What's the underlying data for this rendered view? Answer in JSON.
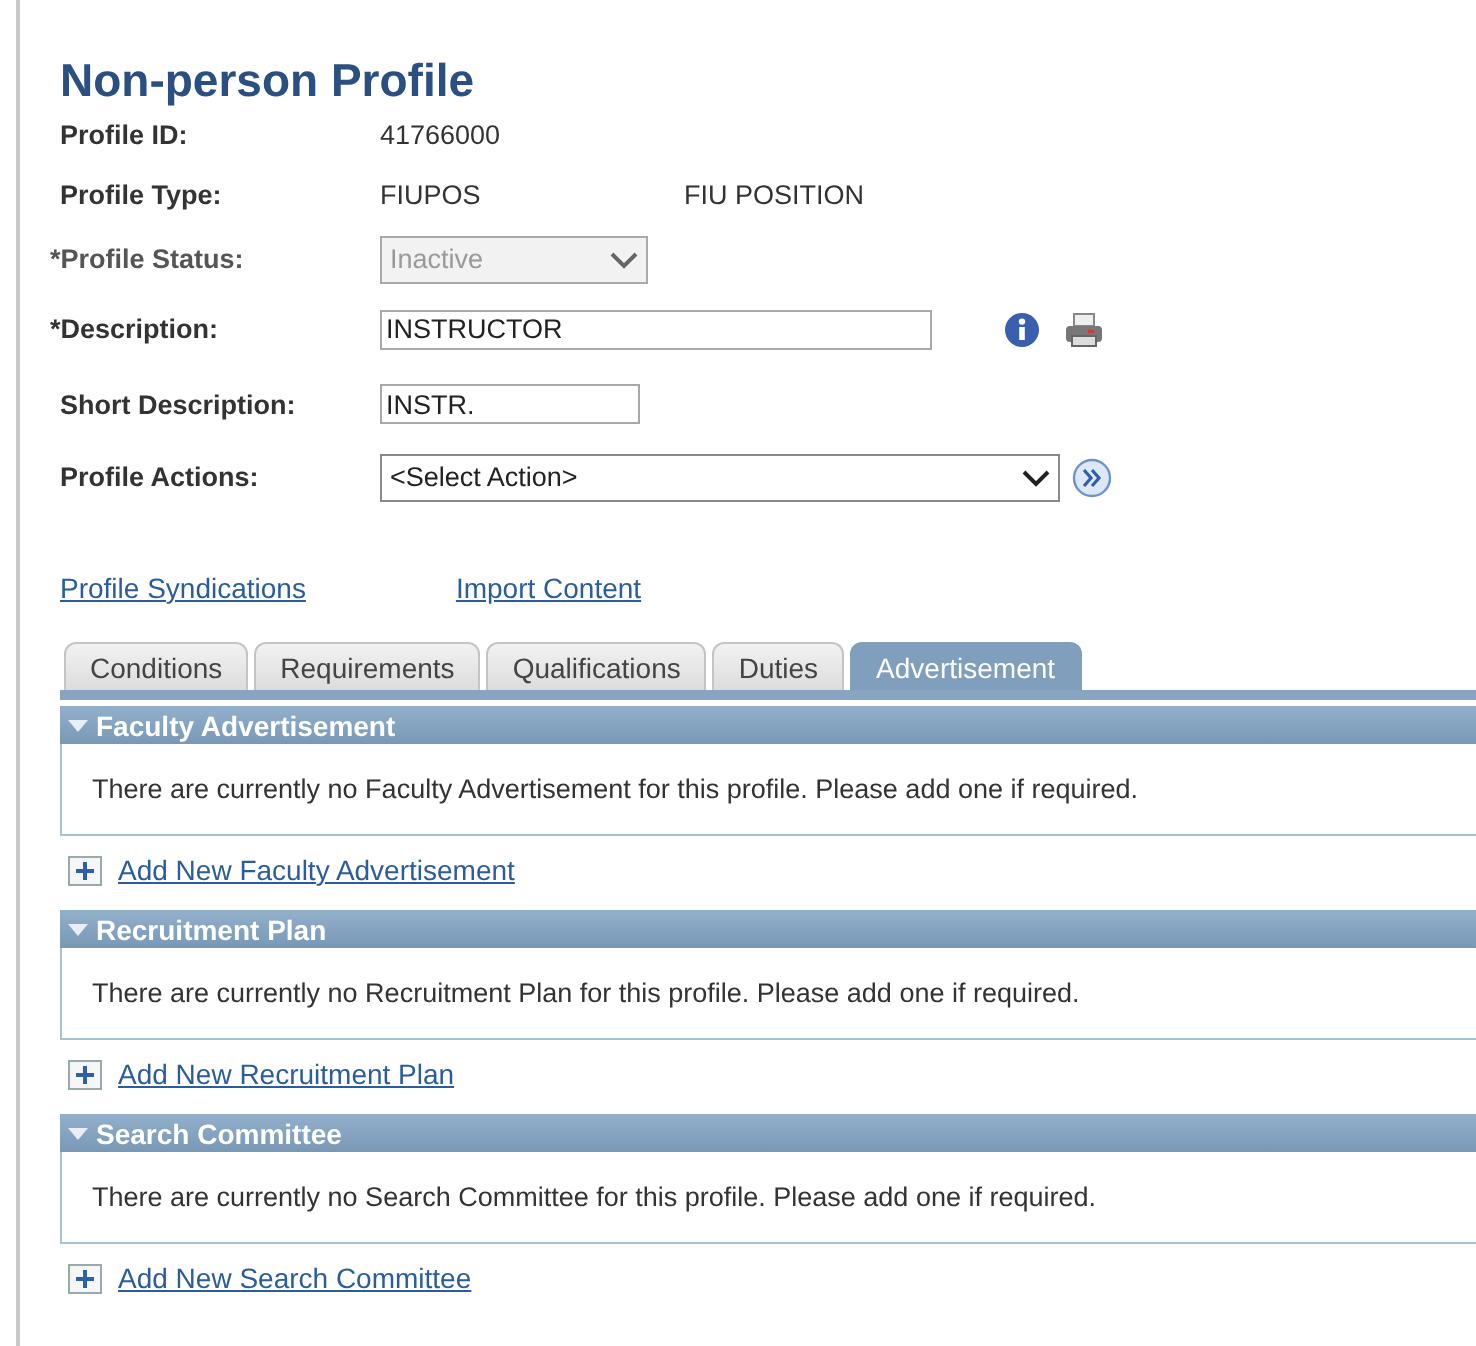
{
  "page_title": "Non-person Profile",
  "fields": [
    {
      "label": "Profile ID:",
      "kind": "text",
      "value": "41766000",
      "disabled": false
    },
    {
      "label": "Profile Type:",
      "kind": "text",
      "value": "FIUPOS",
      "value_2": "FIU POSITION",
      "disabled": false
    },
    {
      "label": "*Profile Status:",
      "kind": "select",
      "value": "Inactive",
      "disabled": true
    },
    {
      "label": "*Description:",
      "kind": "input_long",
      "value": "INSTRUCTOR",
      "disabled": false
    },
    {
      "label": "Short Description:",
      "kind": "input_short",
      "value": "INSTR.",
      "disabled": false
    },
    {
      "label": "Profile Actions:",
      "kind": "action_select",
      "value": "<Select Action>",
      "disabled": false
    }
  ],
  "links": [
    "Profile Syndications",
    "Import Content"
  ],
  "tabs": [
    {
      "label": "Conditions",
      "selected": false
    },
    {
      "label": "Requirements",
      "selected": false
    },
    {
      "label": "Qualifications",
      "selected": false
    },
    {
      "label": "Duties",
      "selected": false
    },
    {
      "label": "Advertisement",
      "selected": true
    }
  ],
  "sections": [
    {
      "title": "Faculty Advertisement",
      "expanded": true,
      "message": "There are currently no Faculty Advertisement for this profile.  Please add one if required.",
      "add_link": "Add New Faculty Advertisement"
    },
    {
      "title": "Recruitment Plan",
      "expanded": true,
      "message": "There are currently no Recruitment Plan for this profile.  Please add one if required.",
      "add_link": "Add New Recruitment Plan"
    },
    {
      "title": "Search Committee",
      "expanded": true,
      "message": "There are currently no Search Committee for this profile.  Please add one if required.",
      "add_link": "Add New Search Committee"
    }
  ]
}
